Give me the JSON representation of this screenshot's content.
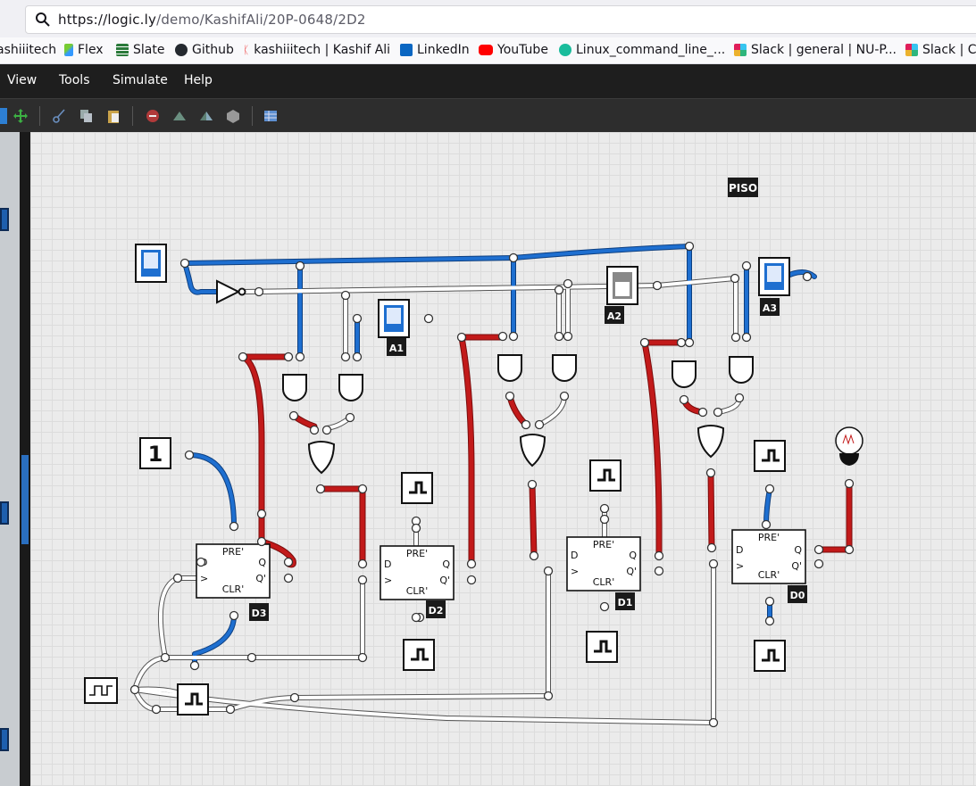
{
  "browser": {
    "url_host": "https://logic.ly",
    "url_path": "/demo/KashifAli/20P-0648/2D2",
    "bookmarks": [
      {
        "label": "ashiiitech",
        "icon": "none"
      },
      {
        "label": "Flex",
        "icon": "flex-icon"
      },
      {
        "label": "Slate",
        "icon": "slate-icon"
      },
      {
        "label": "Github",
        "icon": "github-icon"
      },
      {
        "label": "kashiiitech | Kashif Ali",
        "icon": "k-icon"
      },
      {
        "label": "LinkedIn",
        "icon": "linkedin-icon"
      },
      {
        "label": "YouTube",
        "icon": "youtube-icon"
      },
      {
        "label": "Linux_command_line_...",
        "icon": "tab-icon"
      },
      {
        "label": "Slack | general | NU-P...",
        "icon": "slack-icon"
      },
      {
        "label": "Slack | CC",
        "icon": "slack-icon"
      }
    ]
  },
  "menu": {
    "items": [
      "View",
      "Tools",
      "Simulate",
      "Help"
    ]
  },
  "toolbar": {
    "buttons": [
      "select-tool",
      "pan-tool",
      "cut",
      "copy",
      "paste",
      "delete",
      "rotate-left",
      "rotate-right",
      "group",
      "truth-table"
    ]
  },
  "circuit": {
    "title": "PISO",
    "inputs": {
      "A1": "A1",
      "A2": "A2",
      "A3": "A3"
    },
    "constant": "1",
    "high_constant_symbol": "1",
    "flipflops": [
      {
        "name": "D3",
        "pre": "PRE'",
        "clr": "CLR'",
        "d": "D",
        "clk": ">",
        "q": "Q",
        "qn": "Q'"
      },
      {
        "name": "D2",
        "pre": "PRE'",
        "clr": "CLR'",
        "d": "D",
        "clk": ">",
        "q": "Q",
        "qn": "Q'"
      },
      {
        "name": "D1",
        "pre": "PRE'",
        "clr": "CLR'",
        "d": "D",
        "clk": ">",
        "q": "Q",
        "qn": "Q'"
      },
      {
        "name": "D0",
        "pre": "PRE'",
        "clr": "CLR'",
        "d": "D",
        "clk": ">",
        "q": "Q",
        "qn": "Q'"
      }
    ],
    "colors": {
      "high": "#c21a1a",
      "low": "#1e6fd0",
      "off": "#ffffff",
      "label_bg": "#1a1a1a"
    }
  }
}
